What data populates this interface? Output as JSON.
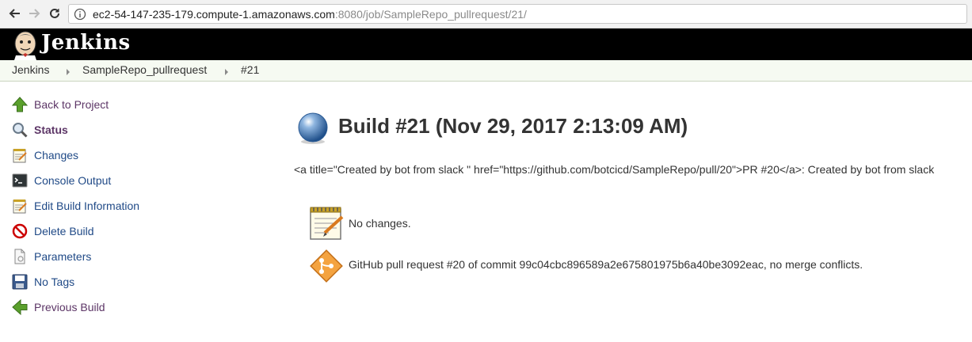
{
  "browser": {
    "url_host": "ec2-54-147-235-179.compute-1.amazonaws.com",
    "url_path": ":8080/job/SampleRepo_pullrequest/21/"
  },
  "header": {
    "app_title": "Jenkins"
  },
  "breadcrumb": {
    "items": [
      "Jenkins",
      "SampleRepo_pullrequest",
      "#21"
    ]
  },
  "sidebar": {
    "items": [
      {
        "label": "Back to Project",
        "icon": "up-arrow-icon"
      },
      {
        "label": "Status",
        "icon": "search-icon"
      },
      {
        "label": "Changes",
        "icon": "notepad-icon"
      },
      {
        "label": "Console Output",
        "icon": "terminal-icon"
      },
      {
        "label": "Edit Build Information",
        "icon": "notepad-icon"
      },
      {
        "label": "Delete Build",
        "icon": "no-entry-icon"
      },
      {
        "label": "Parameters",
        "icon": "document-icon"
      },
      {
        "label": "No Tags",
        "icon": "save-icon"
      },
      {
        "label": "Previous Build",
        "icon": "left-arrow-icon"
      }
    ]
  },
  "main": {
    "build_title": "Build #21 (Nov 29, 2017 2:13:09 AM)",
    "build_status_color": "#4a7ebb",
    "description": "<a title=\"Created by bot from slack \" href=\"https://github.com/botcicd/SampleRepo/pull/20\">PR #20</a>: Created by bot from slack",
    "summary": [
      {
        "icon": "notepad-icon",
        "text": "No changes."
      },
      {
        "icon": "git-merge-icon",
        "text": "GitHub pull request #20 of commit 99c04cbc896589a2e675801975b6a40be3092eac, no merge conflicts."
      }
    ]
  }
}
